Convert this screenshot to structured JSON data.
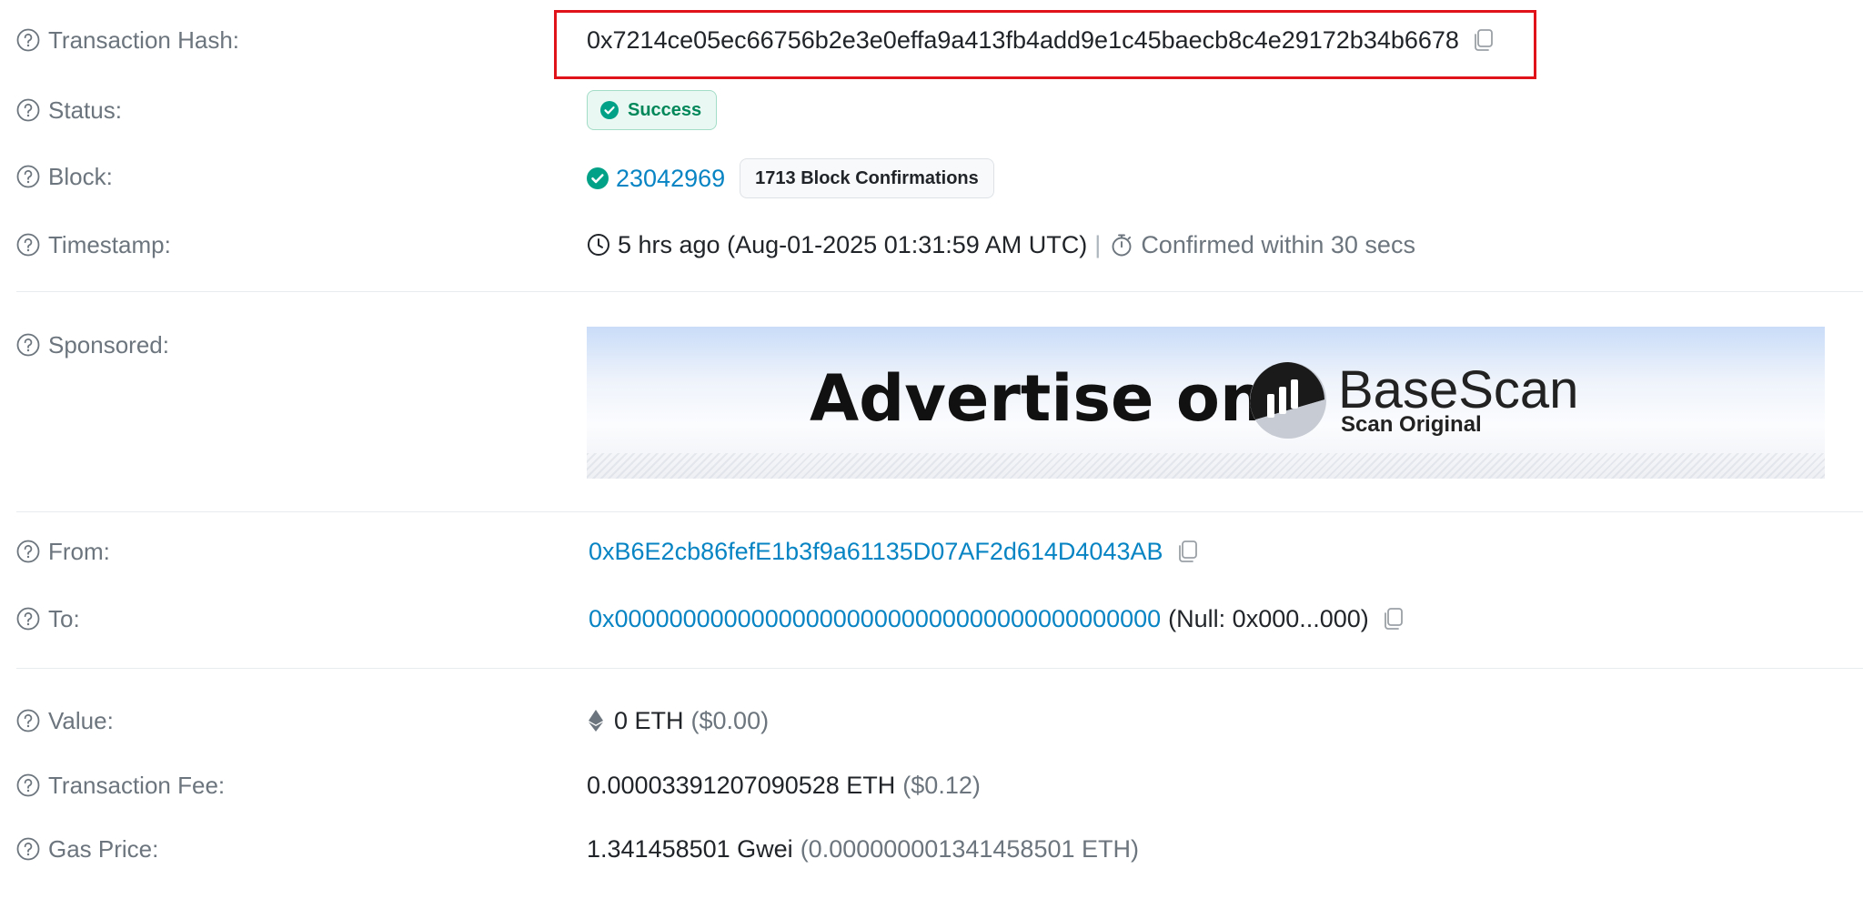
{
  "rows": {
    "tx_hash": {
      "label": "Transaction Hash:",
      "value": "0x7214ce05ec66756b2e3e0effa9a413fb4add9e1c45baecb8c4e29172b34b6678"
    },
    "status": {
      "label": "Status:",
      "value": "Success"
    },
    "block": {
      "label": "Block:",
      "number": "23042969",
      "confirmations": "1713 Block Confirmations"
    },
    "timestamp": {
      "label": "Timestamp:",
      "value": "5 hrs ago (Aug-01-2025 01:31:59 AM UTC)",
      "separator": "|",
      "confirmed": "Confirmed within 30 secs"
    },
    "sponsored": {
      "label": "Sponsored:",
      "ad_text": "Advertise on",
      "ad_brand": "BaseScan",
      "ad_tagline": "Scan Original"
    },
    "from": {
      "label": "From:",
      "address": "0xB6E2cb86fefE1b3f9a61135D07AF2d614D4043AB"
    },
    "to": {
      "label": "To:",
      "address": "0x0000000000000000000000000000000000000000",
      "note": "(Null: 0x000...000)"
    },
    "value": {
      "label": "Value:",
      "amount": "0 ETH",
      "usd": "($0.00)"
    },
    "fee": {
      "label": "Transaction Fee:",
      "amount": "0.00003391207090528 ETH",
      "usd": "($0.12)"
    },
    "gas_price": {
      "label": "Gas Price:",
      "amount": "1.341458501 Gwei",
      "eth": "(0.000000001341458501 ETH)"
    }
  },
  "colors": {
    "link": "#0784c3",
    "success": "#00875a",
    "highlight_border": "#e0131a",
    "label": "#6c757d"
  },
  "icons": [
    "question-circle-icon",
    "copy-icon",
    "check-circle-icon",
    "clock-icon",
    "timer-icon",
    "ethereum-icon",
    "basescan-logo-icon"
  ]
}
